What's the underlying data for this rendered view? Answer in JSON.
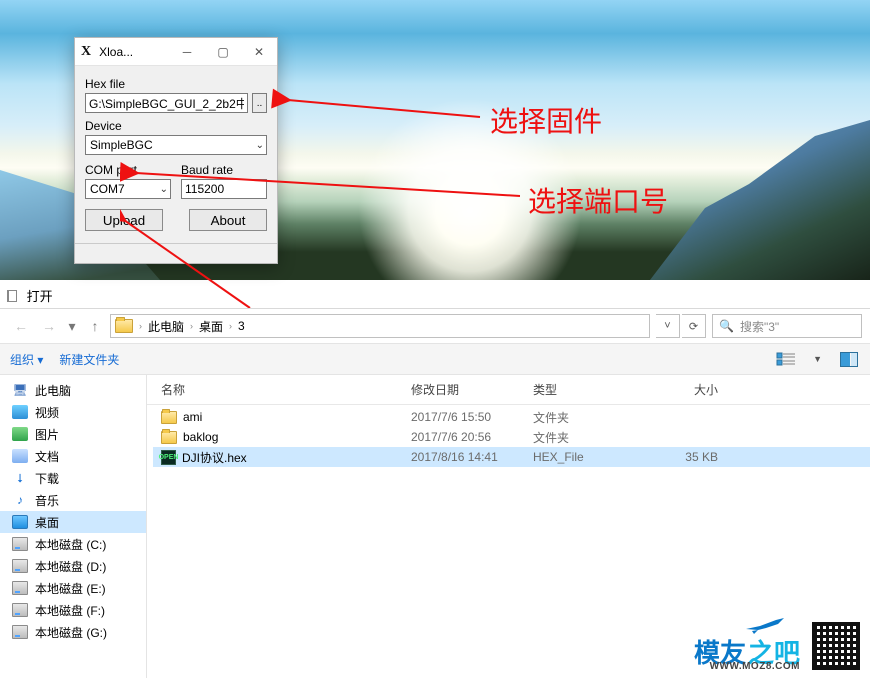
{
  "xloader": {
    "title": "Xloa...",
    "hexfile_label": "Hex file",
    "hexfile_value": "G:\\SimpleBGC_GUI_2_2b2中",
    "browse": "..",
    "device_label": "Device",
    "device_value": "SimpleBGC",
    "comport_label": "COM port",
    "comport_value": "COM7",
    "baud_label": "Baud rate",
    "baud_value": "115200",
    "upload": "Upload",
    "about": "About"
  },
  "annotations": {
    "a1": "选择固件",
    "a2": "选择端口号"
  },
  "explorer": {
    "title": "打开",
    "nav": {
      "back_icon": "←",
      "fwd_icon": "→",
      "dropdown_icon": "▾",
      "up_icon": "↑",
      "crumb1": "此电脑",
      "crumb2": "桌面",
      "crumb3": "3",
      "sep": "›",
      "search_placeholder": "搜索\"3\""
    },
    "toolbar": {
      "organize": "组织 ▾",
      "newfolder": "新建文件夹"
    },
    "columns": {
      "name": "名称",
      "date": "修改日期",
      "type": "类型",
      "size": "大小"
    },
    "sidebar": {
      "this_pc": "此电脑",
      "videos": "视频",
      "pictures": "图片",
      "documents": "文档",
      "downloads": "下载",
      "music": "音乐",
      "desktop": "桌面",
      "diskC": "本地磁盘 (C:)",
      "diskD": "本地磁盘 (D:)",
      "diskE": "本地磁盘 (E:)",
      "diskF": "本地磁盘 (F:)",
      "diskG": "本地磁盘 (G:)"
    },
    "files": [
      {
        "name": "ami",
        "date": "2017/7/6 15:50",
        "type": "文件夹",
        "size": ""
      },
      {
        "name": "baklog",
        "date": "2017/7/6 20:56",
        "type": "文件夹",
        "size": ""
      },
      {
        "name": "DJI协议.hex",
        "date": "2017/8/16 14:41",
        "type": "HEX_File",
        "size": "35 KB"
      }
    ]
  },
  "watermark": {
    "t1": "模友",
    "t2": "之吧",
    "url": "WWW.MOZ8.COM"
  }
}
